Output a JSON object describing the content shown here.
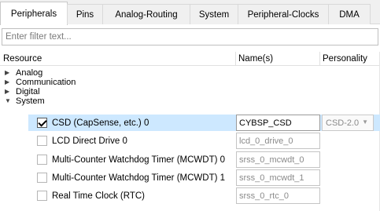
{
  "tabs": [
    {
      "label": "Peripherals",
      "active": true
    },
    {
      "label": "Pins"
    },
    {
      "label": "Analog-Routing"
    },
    {
      "label": "System"
    },
    {
      "label": "Peripheral-Clocks"
    },
    {
      "label": "DMA"
    }
  ],
  "filter": {
    "placeholder": "Enter filter text...",
    "value": ""
  },
  "columns": {
    "resource": "Resource",
    "names": "Name(s)",
    "personality": "Personality"
  },
  "tree": [
    {
      "label": "Analog",
      "expanded": false
    },
    {
      "label": "Communication",
      "expanded": false
    },
    {
      "label": "Digital",
      "expanded": false
    },
    {
      "label": "System",
      "expanded": true
    }
  ],
  "rows": [
    {
      "label": "CSD (CapSense, etc.) 0",
      "checked": true,
      "name": "CYBSP_CSD",
      "personality": "CSD-2.0"
    },
    {
      "label": "LCD Direct Drive 0",
      "checked": false,
      "name": "lcd_0_drive_0"
    },
    {
      "label": "Multi-Counter Watchdog Timer (MCWDT) 0",
      "checked": false,
      "name": "srss_0_mcwdt_0"
    },
    {
      "label": "Multi-Counter Watchdog Timer (MCWDT) 1",
      "checked": false,
      "name": "srss_0_mcwdt_1"
    },
    {
      "label": "Real Time Clock (RTC)",
      "checked": false,
      "name": "srss_0_rtc_0"
    }
  ],
  "colors": {
    "selection": "#cde8ff",
    "tabbar": "#f0f0f0"
  }
}
